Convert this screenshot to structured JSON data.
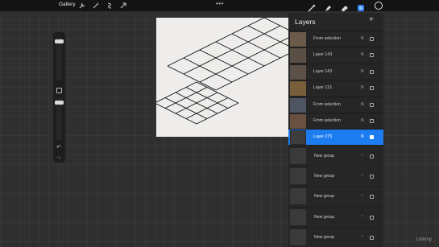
{
  "topbar": {
    "gallery_label": "Gallery",
    "left_tools": [
      "wrench-icon",
      "magic-wand-icon",
      "selection-icon",
      "transform-arrow-icon"
    ],
    "more": "•••",
    "right_tools": [
      "brush-icon",
      "smudge-icon",
      "eraser-icon",
      "layers-icon"
    ],
    "active_tool": "layers-icon",
    "active_color": "#111111"
  },
  "sidebar": {
    "undo_icon": "↶",
    "redo_icon": "↷"
  },
  "layers": {
    "title": "Layers",
    "add_icon": "+",
    "accent": "#1d7df0",
    "rows": [
      {
        "name": "From selection",
        "mode": "N",
        "visible": false
      },
      {
        "name": "Layer 143",
        "mode": "N",
        "visible": false
      },
      {
        "name": "Layer 143",
        "mode": "N",
        "visible": false
      },
      {
        "name": "Layer 113",
        "mode": "N",
        "visible": false
      },
      {
        "name": "From selection",
        "mode": "N",
        "visible": false
      },
      {
        "name": "From selection",
        "mode": "N",
        "visible": false
      },
      {
        "name": "Layer 275",
        "mode": "N",
        "visible": true,
        "selected": true
      }
    ],
    "groups": [
      {
        "name": "New group",
        "chevron": "›"
      },
      {
        "name": "New group",
        "chevron": "›"
      },
      {
        "name": "New group",
        "chevron": "›"
      },
      {
        "name": "New group",
        "chevron": "›"
      },
      {
        "name": "New group",
        "chevron": "›"
      }
    ]
  },
  "watermark": "Udemy"
}
